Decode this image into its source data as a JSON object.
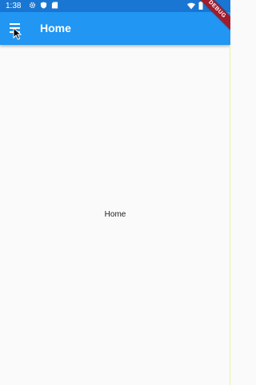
{
  "status_bar": {
    "time": "1:38",
    "left_icons": [
      "gear-icon",
      "shield-icon",
      "sd-card-icon"
    ],
    "right_icons": [
      "wifi-icon",
      "battery-icon"
    ]
  },
  "app_bar": {
    "menu_icon": "hamburger-menu-icon",
    "title": "Home"
  },
  "body": {
    "text": "Home"
  },
  "debug_banner": {
    "label": "DEBUG"
  },
  "colors": {
    "status_bar": "#1976d2",
    "app_bar": "#2196f3",
    "background": "#fafafa",
    "debug_banner": "#a01c2c"
  }
}
